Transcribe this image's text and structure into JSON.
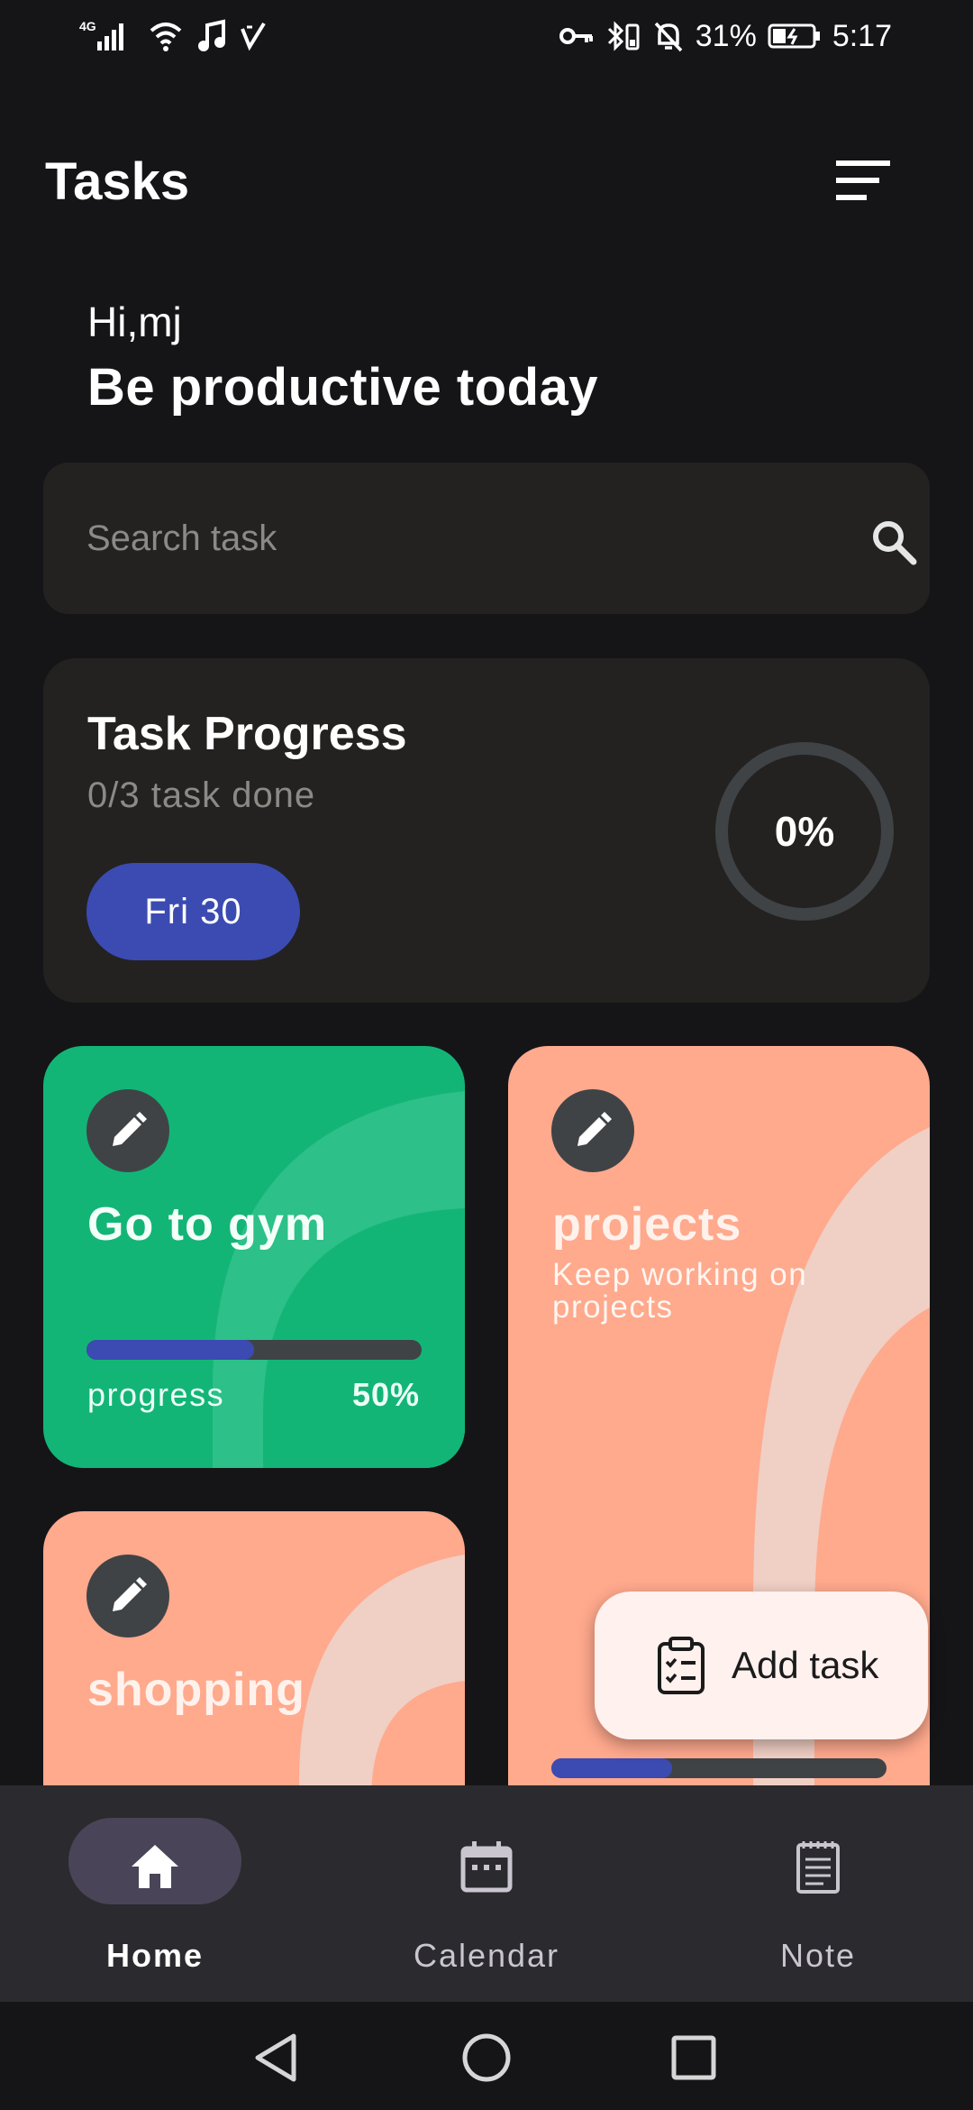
{
  "status_bar": {
    "network": "4G",
    "battery": "31%",
    "time": "5:17"
  },
  "header": {
    "title": "Tasks",
    "menu_icon": "sort-menu-icon"
  },
  "greeting": {
    "hello": "Hi,mj",
    "headline": "Be productive today"
  },
  "search": {
    "placeholder": "Search task",
    "value": "",
    "icon": "search-icon"
  },
  "progress_card": {
    "title": "Task Progress",
    "subtitle": "0/3 task done",
    "date_chip": "Fri 30",
    "percent_label": "0%",
    "percent_value": 0
  },
  "tasks": [
    {
      "title": "Go to gym",
      "description": "",
      "progress_label": "progress",
      "progress_text": "50%",
      "progress_value": 0.5,
      "color": "#13b577"
    },
    {
      "title": "projects",
      "description": "Keep working on projects",
      "progress_value": 0.36,
      "color": "#ffa98d"
    },
    {
      "title": "shopping",
      "description": "",
      "color": "#ffa98d"
    }
  ],
  "fab": {
    "label": "Add task",
    "icon": "clipboard-checklist-icon"
  },
  "bottom_nav": {
    "items": [
      {
        "label": "Home",
        "icon": "home-icon",
        "active": true
      },
      {
        "label": "Calendar",
        "icon": "calendar-icon",
        "active": false
      },
      {
        "label": "Note",
        "icon": "note-icon",
        "active": false
      }
    ]
  },
  "colors": {
    "background": "#151518",
    "card": "#232220",
    "accent": "#3b4bb2",
    "green": "#13b577",
    "salmon": "#ffa98d",
    "nav_active_pill": "#4a4458"
  }
}
